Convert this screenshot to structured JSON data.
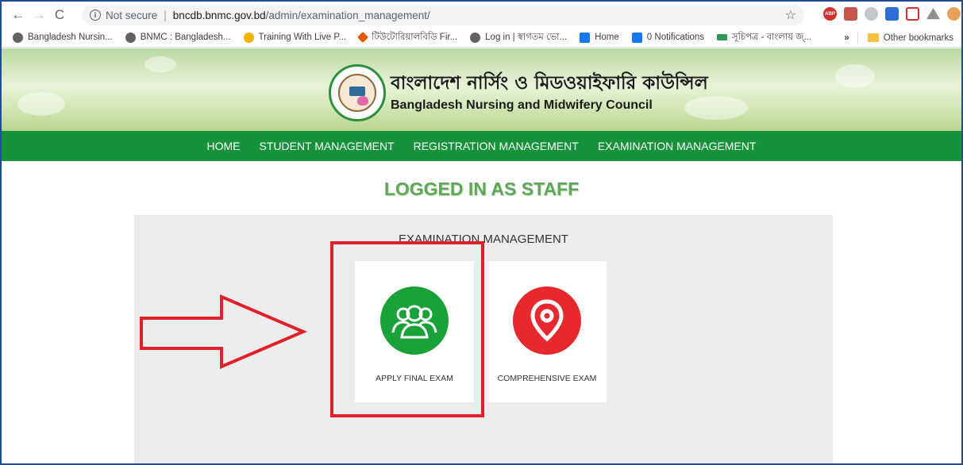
{
  "browser": {
    "url_security": "Not secure",
    "url_host": "bncdb.bnmc.gov.bd",
    "url_path": "/admin/examination_management/",
    "extensions": [
      "star-icon",
      "adblock-icon",
      "pdf-icon",
      "globe-icon",
      "print-icon",
      "arrows-icon",
      "drive-icon",
      "avatar-icon",
      "menu-icon"
    ]
  },
  "bookmarks": {
    "items": [
      {
        "label": "Bangladesh Nursin...",
        "icon": "globe-icon"
      },
      {
        "label": "BNMC : Bangladesh...",
        "icon": "globe-icon"
      },
      {
        "label": "Training With Live P...",
        "icon": "fire-icon"
      },
      {
        "label": "টিউটোরিয়ালবিডি Fir...",
        "icon": "diamond-icon"
      },
      {
        "label": "Log in | স্বাগতম ভো...",
        "icon": "globe-icon"
      },
      {
        "label": "Home",
        "icon": "facebook-icon"
      },
      {
        "label": "0 Notifications",
        "icon": "facebook-icon"
      },
      {
        "label": "সূচিপত্র - বাংলায় জ্...",
        "icon": "bookmark-icon"
      }
    ],
    "overflow": "»",
    "other": "Other bookmarks"
  },
  "site": {
    "title_bn": "বাংলাদেশ নার্সিং ও মিডওয়াইফারি কাউন্সিল",
    "title_en": "Bangladesh Nursing and Midwifery Council",
    "nav": [
      "HOME",
      "STUDENT MANAGEMENT",
      "REGISTRATION MANAGEMENT",
      "EXAMINATION MANAGEMENT"
    ],
    "heading": "LOGGED IN AS STAFF",
    "panel_title": "EXAMINATION MANAGEMENT",
    "cards": [
      {
        "label": "APPLY FINAL EXAM",
        "icon": "users-icon",
        "color": "#19a13a"
      },
      {
        "label": "COMPREHENSIVE EXAM",
        "icon": "map-pin-icon",
        "color": "#e8282f"
      }
    ]
  },
  "annotation": {
    "color": "#e0202a"
  }
}
